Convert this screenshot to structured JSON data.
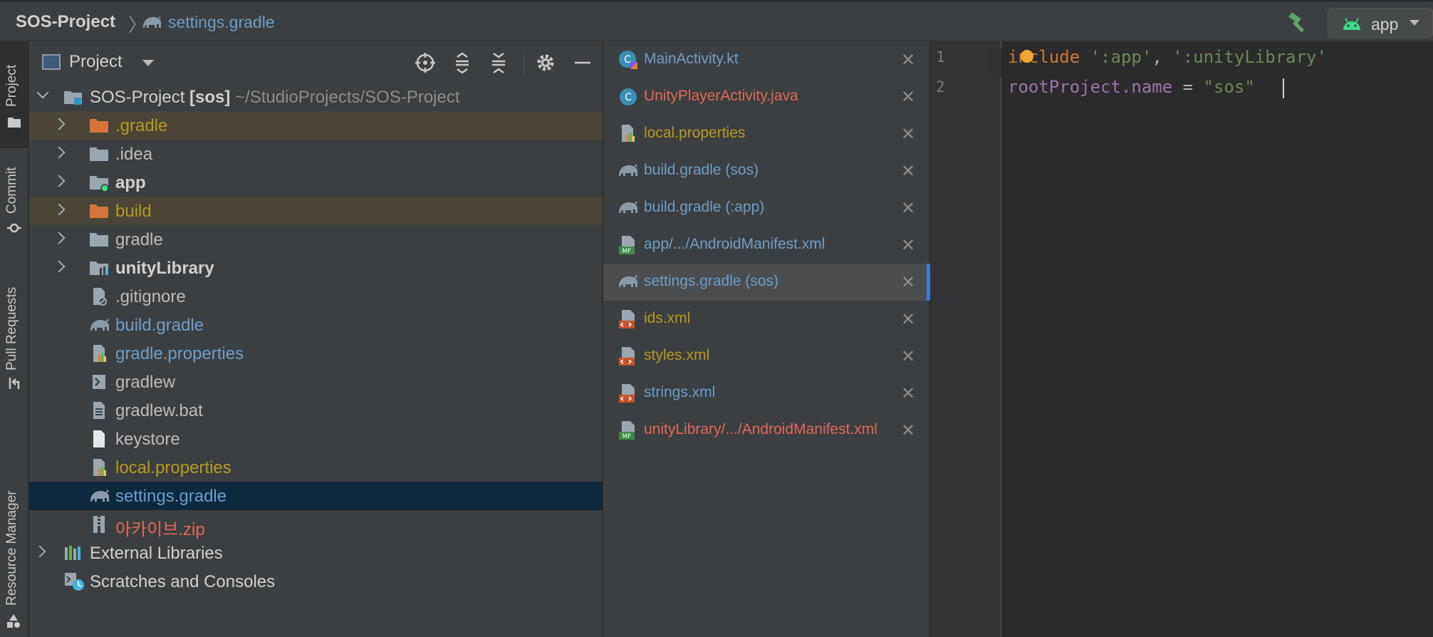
{
  "topbar": {
    "project_name": "SOS-Project",
    "separator": "〉",
    "current_file": "settings.gradle",
    "run_config": "app",
    "build_icon": "hammer-icon",
    "android_icon": "android-icon"
  },
  "stripe": {
    "tabs": [
      "Project",
      "Commit",
      "Pull Requests",
      "Resource Manager"
    ]
  },
  "project_panel": {
    "title": "Project",
    "toolbar": [
      "locate-icon",
      "expand-all-icon",
      "collapse-all-icon",
      "gear-icon",
      "minimize-icon"
    ],
    "root": {
      "name": "SOS-Project",
      "module": "[sos]",
      "path": "~/StudioProjects/SOS-Project"
    },
    "items": [
      {
        "label": ".gradle",
        "color": "#b59a1f",
        "icon": "folder-orange-icon",
        "expandable": true
      },
      {
        "label": ".idea",
        "color": "#bbbbbb",
        "icon": "folder-icon",
        "expandable": true
      },
      {
        "label": "app",
        "color": "#d0d0d0",
        "icon": "module-folder-icon",
        "expandable": true,
        "bold": true
      },
      {
        "label": "build",
        "color": "#b59a1f",
        "icon": "folder-orange-icon",
        "expandable": true
      },
      {
        "label": "gradle",
        "color": "#bbbbbb",
        "icon": "folder-icon",
        "expandable": true
      },
      {
        "label": "unityLibrary",
        "color": "#d0d0d0",
        "icon": "library-module-icon",
        "expandable": true,
        "bold": true
      },
      {
        "label": ".gitignore",
        "color": "#bbbbbb",
        "icon": "gitignore-file-icon",
        "expandable": false
      },
      {
        "label": "build.gradle",
        "color": "#6b9ec9",
        "icon": "gradle-elephant-icon",
        "expandable": false
      },
      {
        "label": "gradle.properties",
        "color": "#6b9ec9",
        "icon": "properties-file-icon",
        "expandable": false
      },
      {
        "label": "gradlew",
        "color": "#bbbbbb",
        "icon": "shell-script-icon",
        "expandable": false
      },
      {
        "label": "gradlew.bat",
        "color": "#bbbbbb",
        "icon": "text-file-icon",
        "expandable": false
      },
      {
        "label": "keystore",
        "color": "#bbbbbb",
        "icon": "blank-file-icon",
        "expandable": false
      },
      {
        "label": "local.properties",
        "color": "#b59a1f",
        "icon": "properties-file-icon",
        "expandable": false
      },
      {
        "label": "settings.gradle",
        "color": "#6b9ec9",
        "icon": "gradle-elephant-icon",
        "expandable": false
      },
      {
        "label": "아카이브.zip",
        "color": "#e0685a",
        "icon": "zip-file-icon",
        "expandable": false
      }
    ],
    "external_libraries": "External Libraries",
    "scratches": "Scratches and Consoles"
  },
  "tab_list": [
    {
      "label": "MainActivity.kt",
      "color": "#6b9ec9",
      "icon": "kotlin-class-icon"
    },
    {
      "label": "UnityPlayerActivity.java",
      "color": "#e0685a",
      "icon": "java-class-icon"
    },
    {
      "label": "local.properties",
      "color": "#b59a1f",
      "icon": "properties-file-icon"
    },
    {
      "label": "build.gradle (sos)",
      "color": "#6b9ec9",
      "icon": "gradle-elephant-icon"
    },
    {
      "label": "build.gradle (:app)",
      "color": "#6b9ec9",
      "icon": "gradle-elephant-icon"
    },
    {
      "label": "app/.../AndroidManifest.xml",
      "color": "#6b9ec9",
      "icon": "manifest-file-icon"
    },
    {
      "label": "settings.gradle (sos)",
      "color": "#6b9ec9",
      "icon": "gradle-elephant-icon",
      "selected": true
    },
    {
      "label": "ids.xml",
      "color": "#b59a1f",
      "icon": "xml-file-icon"
    },
    {
      "label": "styles.xml",
      "color": "#b59a1f",
      "icon": "xml-file-icon"
    },
    {
      "label": "strings.xml",
      "color": "#6b9ec9",
      "icon": "xml-file-icon"
    },
    {
      "label": "unityLibrary/.../AndroidManifest.xml",
      "color": "#e0685a",
      "icon": "manifest-file-icon"
    }
  ],
  "tab_close_glyph": "✕",
  "editor": {
    "line_numbers": [
      "1",
      "2"
    ],
    "line1": {
      "kw": "include",
      "space": " ",
      "s1": "':app'",
      "comma": ", ",
      "s2": "':unityLibrary'"
    },
    "line2": {
      "id": "rootProject.name",
      "eq": " = ",
      "val": "\"sos\""
    }
  }
}
